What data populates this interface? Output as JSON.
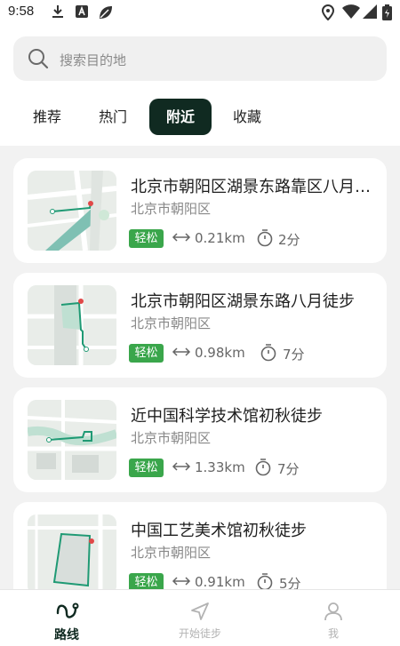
{
  "status_bar": {
    "time": "9:58"
  },
  "search": {
    "placeholder": "搜索目的地"
  },
  "tabs": [
    {
      "label": "推荐",
      "active": false
    },
    {
      "label": "热门",
      "active": false
    },
    {
      "label": "附近",
      "active": true
    },
    {
      "label": "收藏",
      "active": false
    }
  ],
  "routes": [
    {
      "title": "北京市朝阳区湖景东路靠区八月…",
      "location": "北京市朝阳区",
      "difficulty": "轻松",
      "distance": "0.21km",
      "duration": "2分"
    },
    {
      "title": "北京市朝阳区湖景东路八月徒步",
      "location": "北京市朝阳区",
      "difficulty": "轻松",
      "distance": "0.98km",
      "duration": "7分"
    },
    {
      "title": "近中国科学技术馆初秋徒步",
      "location": "北京市朝阳区",
      "difficulty": "轻松",
      "distance": "1.33km",
      "duration": "7分"
    },
    {
      "title": "中国工艺美术馆初秋徒步",
      "location": "北京市朝阳区",
      "difficulty": "轻松",
      "distance": "0.91km",
      "duration": "5分"
    }
  ],
  "bottom_nav": [
    {
      "label": "路线",
      "icon": "route-icon",
      "active": true
    },
    {
      "label": "开始徒步",
      "icon": "navigation-icon",
      "active": false
    },
    {
      "label": "我",
      "icon": "person-icon",
      "active": false
    }
  ],
  "colors": {
    "accent": "#102a21",
    "badge": "#3aa64b",
    "route_line": "#1f9a74"
  }
}
